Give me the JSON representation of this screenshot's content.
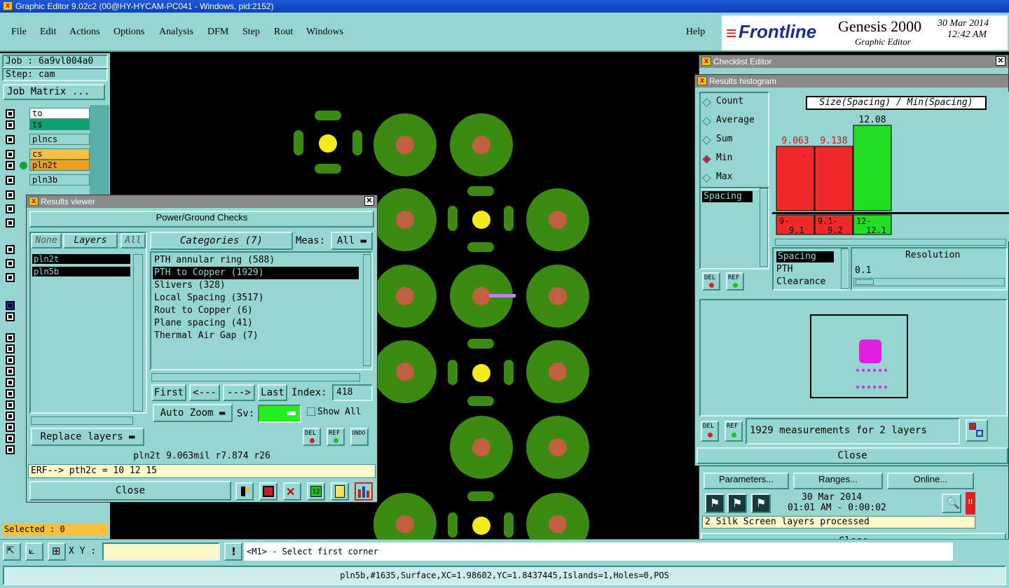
{
  "window": {
    "title": "Graphic Editor 9.02c2 (00@HY-HYCAM-PC041 - Windows, pid:2152)"
  },
  "menu": {
    "items": [
      "File",
      "Edit",
      "Actions",
      "Options",
      "Analysis",
      "DFM",
      "Step",
      "Rout",
      "Windows"
    ],
    "help": "Help"
  },
  "brand": {
    "logo": "Frontline",
    "product": "Genesis 2000",
    "subtitle": "Graphic Editor",
    "date": "30 Mar 2014",
    "time": "12:42 AM"
  },
  "left": {
    "job": "Job : 6a9vl004a0",
    "step": "Step: cam",
    "job_matrix": "Job Matrix ...",
    "layers": [
      "to",
      "ts",
      "plncs",
      "cs",
      "pln2t",
      "pln3b"
    ],
    "selected": "Selected : 0"
  },
  "results_viewer": {
    "title": "Results viewer",
    "header": "Power/Ground Checks",
    "none": "None",
    "layers": "Layers",
    "all": "All",
    "categories": "Categories (7)",
    "meas_label": "Meas:",
    "meas_value": "All",
    "layer_list": [
      "pln2t",
      "pln5b"
    ],
    "category_list": [
      "PTH annular ring (588)",
      "PTH to Copper (1929)",
      "Slivers (328)",
      "Local Spacing (3517)",
      "Rout to Copper (6)",
      "Plane spacing (41)",
      "Thermal Air Gap (7)"
    ],
    "selected_category": 1,
    "first": "First",
    "prev": "<---",
    "next": "--->",
    "last": "Last",
    "index_label": "Index:",
    "index_value": "418",
    "auto_zoom": "Auto Zoom",
    "sv_label": "Sv:",
    "show_all": "Show All",
    "replace_layers": "Replace layers",
    "del": "DEL",
    "ref": "REF",
    "undo": "UNDO",
    "status": "pln2t 9.063mil  r7.874  r26",
    "erf": "ERF--> pth2c = 10 12 15",
    "close": "Close"
  },
  "checklist": {
    "title": "Checklist Editor",
    "parameters": "Parameters...",
    "ranges": "Ranges...",
    "online": "Online...",
    "date": "30 Mar 2014",
    "time": "01:01 AM - 0:00:02",
    "message": "2 Silk Screen layers processed",
    "close": "Close"
  },
  "histogram": {
    "title": "Results histogram",
    "modes": [
      "Count",
      "Average",
      "Sum",
      "Min",
      "Max"
    ],
    "selected_mode": 3,
    "chart_title": "Size(Spacing) / Min(Spacing)",
    "list1": [
      "Spacing"
    ],
    "list2": [
      "Spacing",
      "PTH",
      "Clearance"
    ],
    "resolution_label": "Resolution",
    "resolution_value": "0.1",
    "measurements": "1929 measurements for 2 layers",
    "close": "Close",
    "del": "DEL",
    "ref": "REF"
  },
  "chart_data": {
    "type": "bar",
    "title": "Size(Spacing) / Min(Spacing)",
    "categories": [
      "9-9.1",
      "9.1-9.2",
      "12-12.1"
    ],
    "values": [
      9.063,
      9.138,
      12.08
    ],
    "colors": [
      "#f02a2a",
      "#f02a2a",
      "#22dd22"
    ]
  },
  "bottom": {
    "xy_label": "X Y :",
    "prompt": "<M1> - Select first corner",
    "status": "pln5b,#1635,Surface,XC=1.98602,YC=1.8437445,Islands=1,Holes=0,POS"
  }
}
